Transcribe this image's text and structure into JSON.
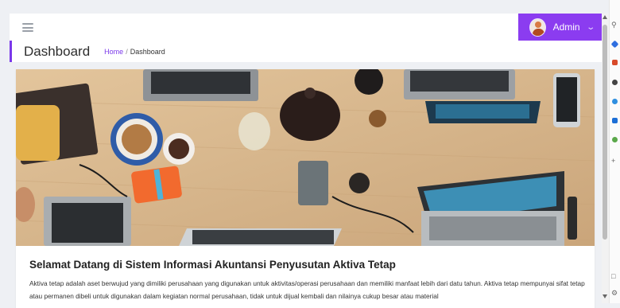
{
  "header": {
    "user_name": "Admin",
    "menu_icon": "hamburger-icon",
    "dropdown_icon": "chevron-down-icon",
    "accent_color": "#8b3cf0"
  },
  "page": {
    "title": "Dashboard",
    "breadcrumb": {
      "home": "Home",
      "separator": "/",
      "current": "Dashboard"
    }
  },
  "welcome": {
    "image": "workspace-desk-photo",
    "title": "Selamat Datang di Sistem Informasi Akuntansi Penyusutan Aktiva Tetap",
    "text": "Aktiva tetap adalah aset berwujud yang dimiliki perusahaan yang digunakan untuk aktivitas/operasi perusahaan dan memiliki manfaat lebih dari datu tahun. Aktiva tetap mempunyai sifat tetap atau permanen dibeli untuk digunakan dalam kegiatan normal perusahaan, tidak untuk dijual kembali dan nilainya cukup besar atau material"
  },
  "side_panel": {
    "icons": [
      "search-icon",
      "diamond-icon",
      "bag-icon",
      "person-icon",
      "globe-icon",
      "outlook-icon",
      "tree-icon",
      "plus-icon",
      "panel-icon",
      "gear-icon"
    ]
  }
}
